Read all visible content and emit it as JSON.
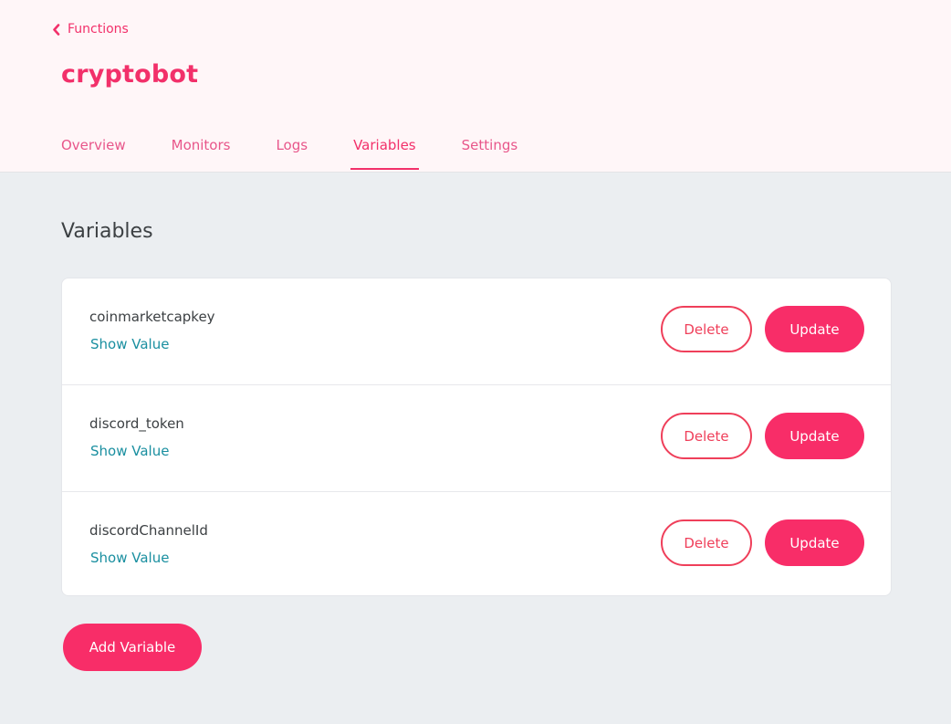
{
  "header": {
    "back_label": "Functions",
    "app_title": "cryptobot",
    "tabs": [
      {
        "label": "Overview",
        "active": false
      },
      {
        "label": "Monitors",
        "active": false
      },
      {
        "label": "Logs",
        "active": false
      },
      {
        "label": "Variables",
        "active": true
      },
      {
        "label": "Settings",
        "active": false
      }
    ]
  },
  "main": {
    "section_title": "Variables",
    "variables": [
      {
        "name": "coinmarketcapkey",
        "show_label": "Show Value",
        "delete_label": "Delete",
        "update_label": "Update"
      },
      {
        "name": "discord_token",
        "show_label": "Show Value",
        "delete_label": "Delete",
        "update_label": "Update"
      },
      {
        "name": "discordChannelId",
        "show_label": "Show Value",
        "delete_label": "Delete",
        "update_label": "Update"
      }
    ],
    "add_label": "Add Variable"
  },
  "icons": {
    "back": "chevron-left-icon"
  },
  "colors": {
    "accent": "#f2306a",
    "button_fill": "#f82d68",
    "delete_outline": "#ef3f5a",
    "link": "#1a8fa0",
    "header_bg": "#fff6f8",
    "page_bg": "#ebeef1"
  }
}
